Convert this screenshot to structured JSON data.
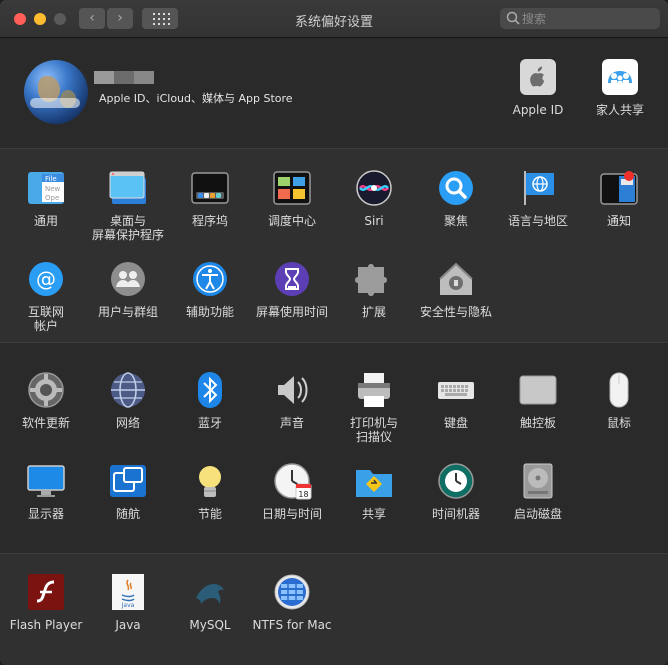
{
  "window": {
    "title": "系统偏好设置"
  },
  "toolbar": {
    "back": "‹",
    "forward": "›"
  },
  "search": {
    "placeholder": "搜索"
  },
  "account": {
    "subtitle": "Apple ID、iCloud、媒体与 App Store"
  },
  "top_items": [
    {
      "label": "Apple ID",
      "icon": "apple-id-icon"
    },
    {
      "label": "家人共享",
      "icon": "family-sharing-icon"
    }
  ],
  "section1": [
    {
      "label": "通用",
      "icon": "general-icon"
    },
    {
      "label": "桌面与\n屏幕保护程序",
      "icon": "desktop-screensaver-icon"
    },
    {
      "label": "程序坞",
      "icon": "dock-icon"
    },
    {
      "label": "调度中心",
      "icon": "mission-control-icon"
    },
    {
      "label": "Siri",
      "icon": "siri-icon"
    },
    {
      "label": "聚焦",
      "icon": "spotlight-icon"
    },
    {
      "label": "语言与地区",
      "icon": "language-region-icon"
    },
    {
      "label": "通知",
      "icon": "notifications-icon"
    },
    {
      "label": "互联网\n帐户",
      "icon": "internet-accounts-icon"
    },
    {
      "label": "用户与群组",
      "icon": "users-groups-icon"
    },
    {
      "label": "辅助功能",
      "icon": "accessibility-icon"
    },
    {
      "label": "屏幕使用时间",
      "icon": "screen-time-icon"
    },
    {
      "label": "扩展",
      "icon": "extensions-icon"
    },
    {
      "label": "安全性与隐私",
      "icon": "security-privacy-icon"
    }
  ],
  "section2": [
    {
      "label": "软件更新",
      "icon": "software-update-icon"
    },
    {
      "label": "网络",
      "icon": "network-icon"
    },
    {
      "label": "蓝牙",
      "icon": "bluetooth-icon"
    },
    {
      "label": "声音",
      "icon": "sound-icon"
    },
    {
      "label": "打印机与\n扫描仪",
      "icon": "printers-scanners-icon"
    },
    {
      "label": "键盘",
      "icon": "keyboard-icon"
    },
    {
      "label": "触控板",
      "icon": "trackpad-icon"
    },
    {
      "label": "鼠标",
      "icon": "mouse-icon"
    },
    {
      "label": "显示器",
      "icon": "displays-icon"
    },
    {
      "label": "随航",
      "icon": "sidecar-icon"
    },
    {
      "label": "节能",
      "icon": "energy-saver-icon"
    },
    {
      "label": "日期与时间",
      "icon": "date-time-icon"
    },
    {
      "label": "共享",
      "icon": "sharing-icon"
    },
    {
      "label": "时间机器",
      "icon": "time-machine-icon"
    },
    {
      "label": "启动磁盘",
      "icon": "startup-disk-icon"
    }
  ],
  "section3": [
    {
      "label": "Flash Player",
      "icon": "flash-player-icon"
    },
    {
      "label": "Java",
      "icon": "java-icon"
    },
    {
      "label": "MySQL",
      "icon": "mysql-icon"
    },
    {
      "label": "NTFS for Mac",
      "icon": "ntfs-icon"
    }
  ],
  "colors": {
    "background": "#2a2a2a",
    "alt_background": "#303030",
    "text": "#dcdcdc",
    "accent": "#1e8cf0"
  }
}
